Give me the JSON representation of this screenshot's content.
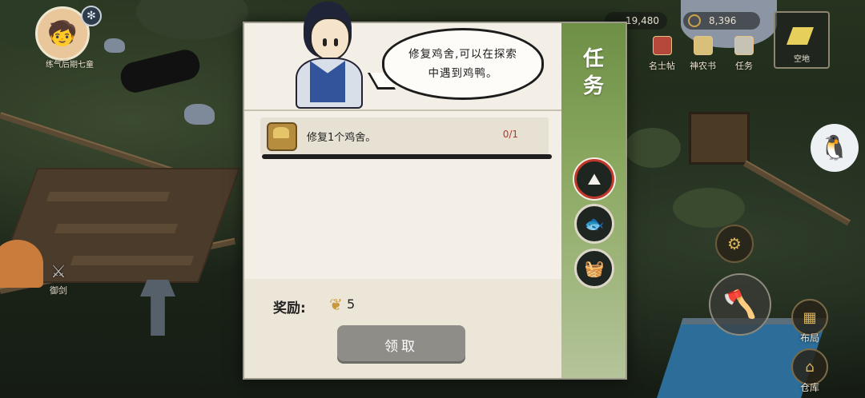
{
  "hud": {
    "player_name": "练气后期七童",
    "currency_1": "19,480",
    "currency_2": "8,396",
    "nav": [
      "名士帖",
      "神农书",
      "任务"
    ],
    "empty_slot_label": "空地",
    "right_buttons": [
      "布局",
      "仓库"
    ],
    "sword_label": "御剑"
  },
  "quest": {
    "title": "任务",
    "dialogue": "修复鸡舍,可以在探索中遇到鸡鸭。",
    "task_label": "修复1个鸡舍。",
    "task_progress": "0/1",
    "reward_label": "奖励:",
    "reward_count": "5",
    "claim_label": "领取",
    "tabs": [
      "mountain-icon",
      "fish-icon",
      "basket-icon"
    ]
  },
  "colors": {
    "strip_green": "#6e8f46",
    "progress_red": "#b3382b",
    "claim_gray": "#8f8d87",
    "active_tab_ring": "#c0392b"
  }
}
